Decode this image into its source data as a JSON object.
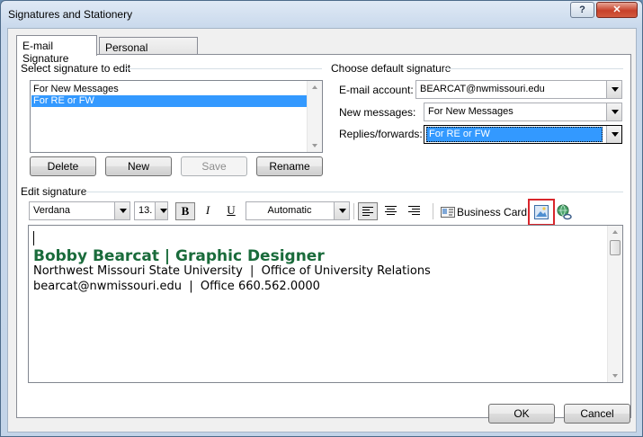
{
  "window": {
    "title": "Signatures and Stationery",
    "help": "?",
    "close": "✕"
  },
  "tabs": [
    {
      "label": "E-mail Signature",
      "active": true
    },
    {
      "label": "Personal Stationery",
      "active": false
    }
  ],
  "select_signature": {
    "heading": "Select signature to edit",
    "items": [
      {
        "label": "For New Messages",
        "selected": false
      },
      {
        "label": "For RE or FW",
        "selected": true
      }
    ],
    "buttons": {
      "delete": "Delete",
      "new": "New",
      "save": "Save",
      "rename": "Rename"
    }
  },
  "default_signature": {
    "heading": "Choose default signature",
    "email_account_label": "E-mail account:",
    "email_account_value": "BEARCAT@nwmissouri.edu",
    "new_messages_label": "New messages:",
    "new_messages_value": "For New Messages",
    "replies_label": "Replies/forwards:",
    "replies_value": "For RE or FW"
  },
  "edit_signature": {
    "heading": "Edit signature",
    "font": "Verdana",
    "size": "13.",
    "bold": "B",
    "italic": "I",
    "underline": "U",
    "color": "Automatic",
    "business_card": "Business Card",
    "icons": [
      "business-card-icon",
      "insert-picture-icon",
      "insert-hyperlink-icon"
    ]
  },
  "signature_content": {
    "name_line": "Bobby Bearcat | Graphic Designer",
    "line2": "Northwest Missouri State University  |  Office of University Relations",
    "line3": "bearcat@nwmissouri.edu  |  Office 660.562.0000",
    "name_color": "#1a6b3b"
  },
  "footer": {
    "ok": "OK",
    "cancel": "Cancel"
  },
  "colors": {
    "selection": "#3399ff",
    "highlight_box": "#d9262c"
  }
}
